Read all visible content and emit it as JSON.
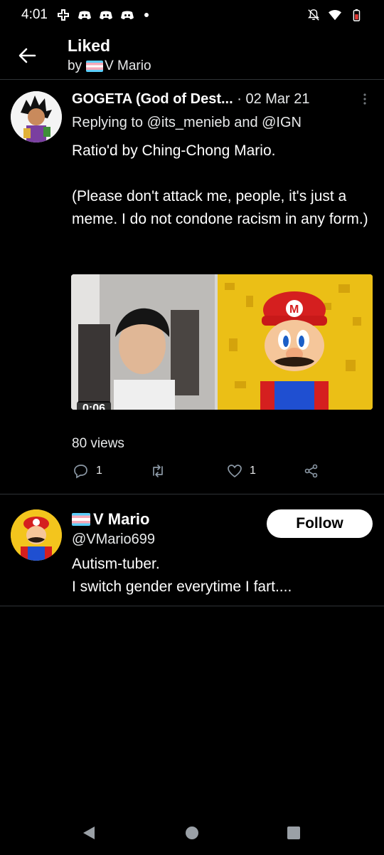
{
  "status_bar": {
    "time": "4:01",
    "left_icons": [
      "game-controller-icon",
      "discord-icon",
      "discord-icon",
      "discord-icon",
      "dot-icon"
    ],
    "right_icons": [
      "notifications-off-icon",
      "wifi-icon",
      "battery-low-icon"
    ]
  },
  "header": {
    "title": "Liked",
    "by_prefix": "by",
    "by_name": "V Mario"
  },
  "tweet": {
    "author": "GOGETA (God of Dest...",
    "date": "· 02 Mar 21",
    "replying_to": "Replying to @its_menieb and @IGN",
    "text": "Ratio'd by Ching-Chong Mario.\n\n(Please don't attack me, people, it's just a meme. I do not condone racism in any form.)",
    "video_duration": "0:06",
    "views": "80 views",
    "reply_count": "1",
    "like_count": "1"
  },
  "user_card": {
    "name": "V Mario",
    "handle": "@VMario699",
    "bio": "Autism-tuber.\nI switch gender everytime I fart....",
    "follow_label": "Follow"
  },
  "colors": {
    "background": "#000000",
    "divider": "#2f3336",
    "text": "#e7e9ea",
    "trans_blue": "#5bcefa",
    "trans_pink": "#f5a9b8"
  }
}
